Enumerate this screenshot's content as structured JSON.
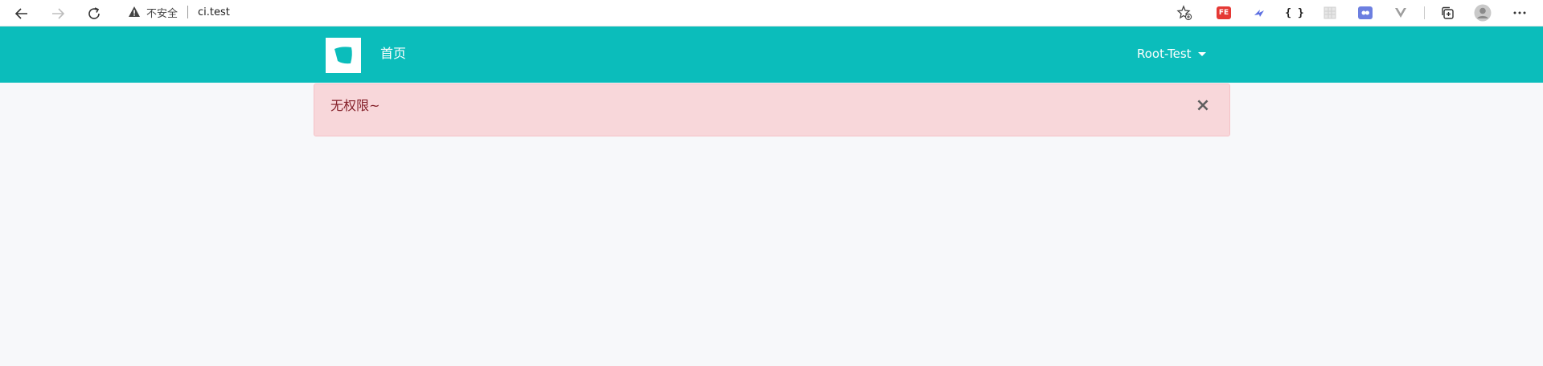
{
  "browser": {
    "security_label": "不安全",
    "url": "ci.test",
    "extensions": [
      {
        "name": "fe-helper",
        "label": "FE",
        "color": "#e53935"
      },
      {
        "name": "swift-ext",
        "label": "",
        "color": "#5b6ee1"
      },
      {
        "name": "json-viewer",
        "label": "{ }",
        "color": "#222222"
      },
      {
        "name": "grid-ext",
        "label": "",
        "color": "#d8d8d8"
      },
      {
        "name": "tamper-ext",
        "label": "",
        "color": "#6c7fe0"
      },
      {
        "name": "vue-devtools",
        "label": "",
        "color": "#9e9e9e"
      }
    ]
  },
  "navbar": {
    "brand_color": "#0bbdbb",
    "home_label": "首页",
    "user_label": "Root-Test"
  },
  "alert": {
    "message": "无权限~",
    "close_symbol": "×"
  }
}
